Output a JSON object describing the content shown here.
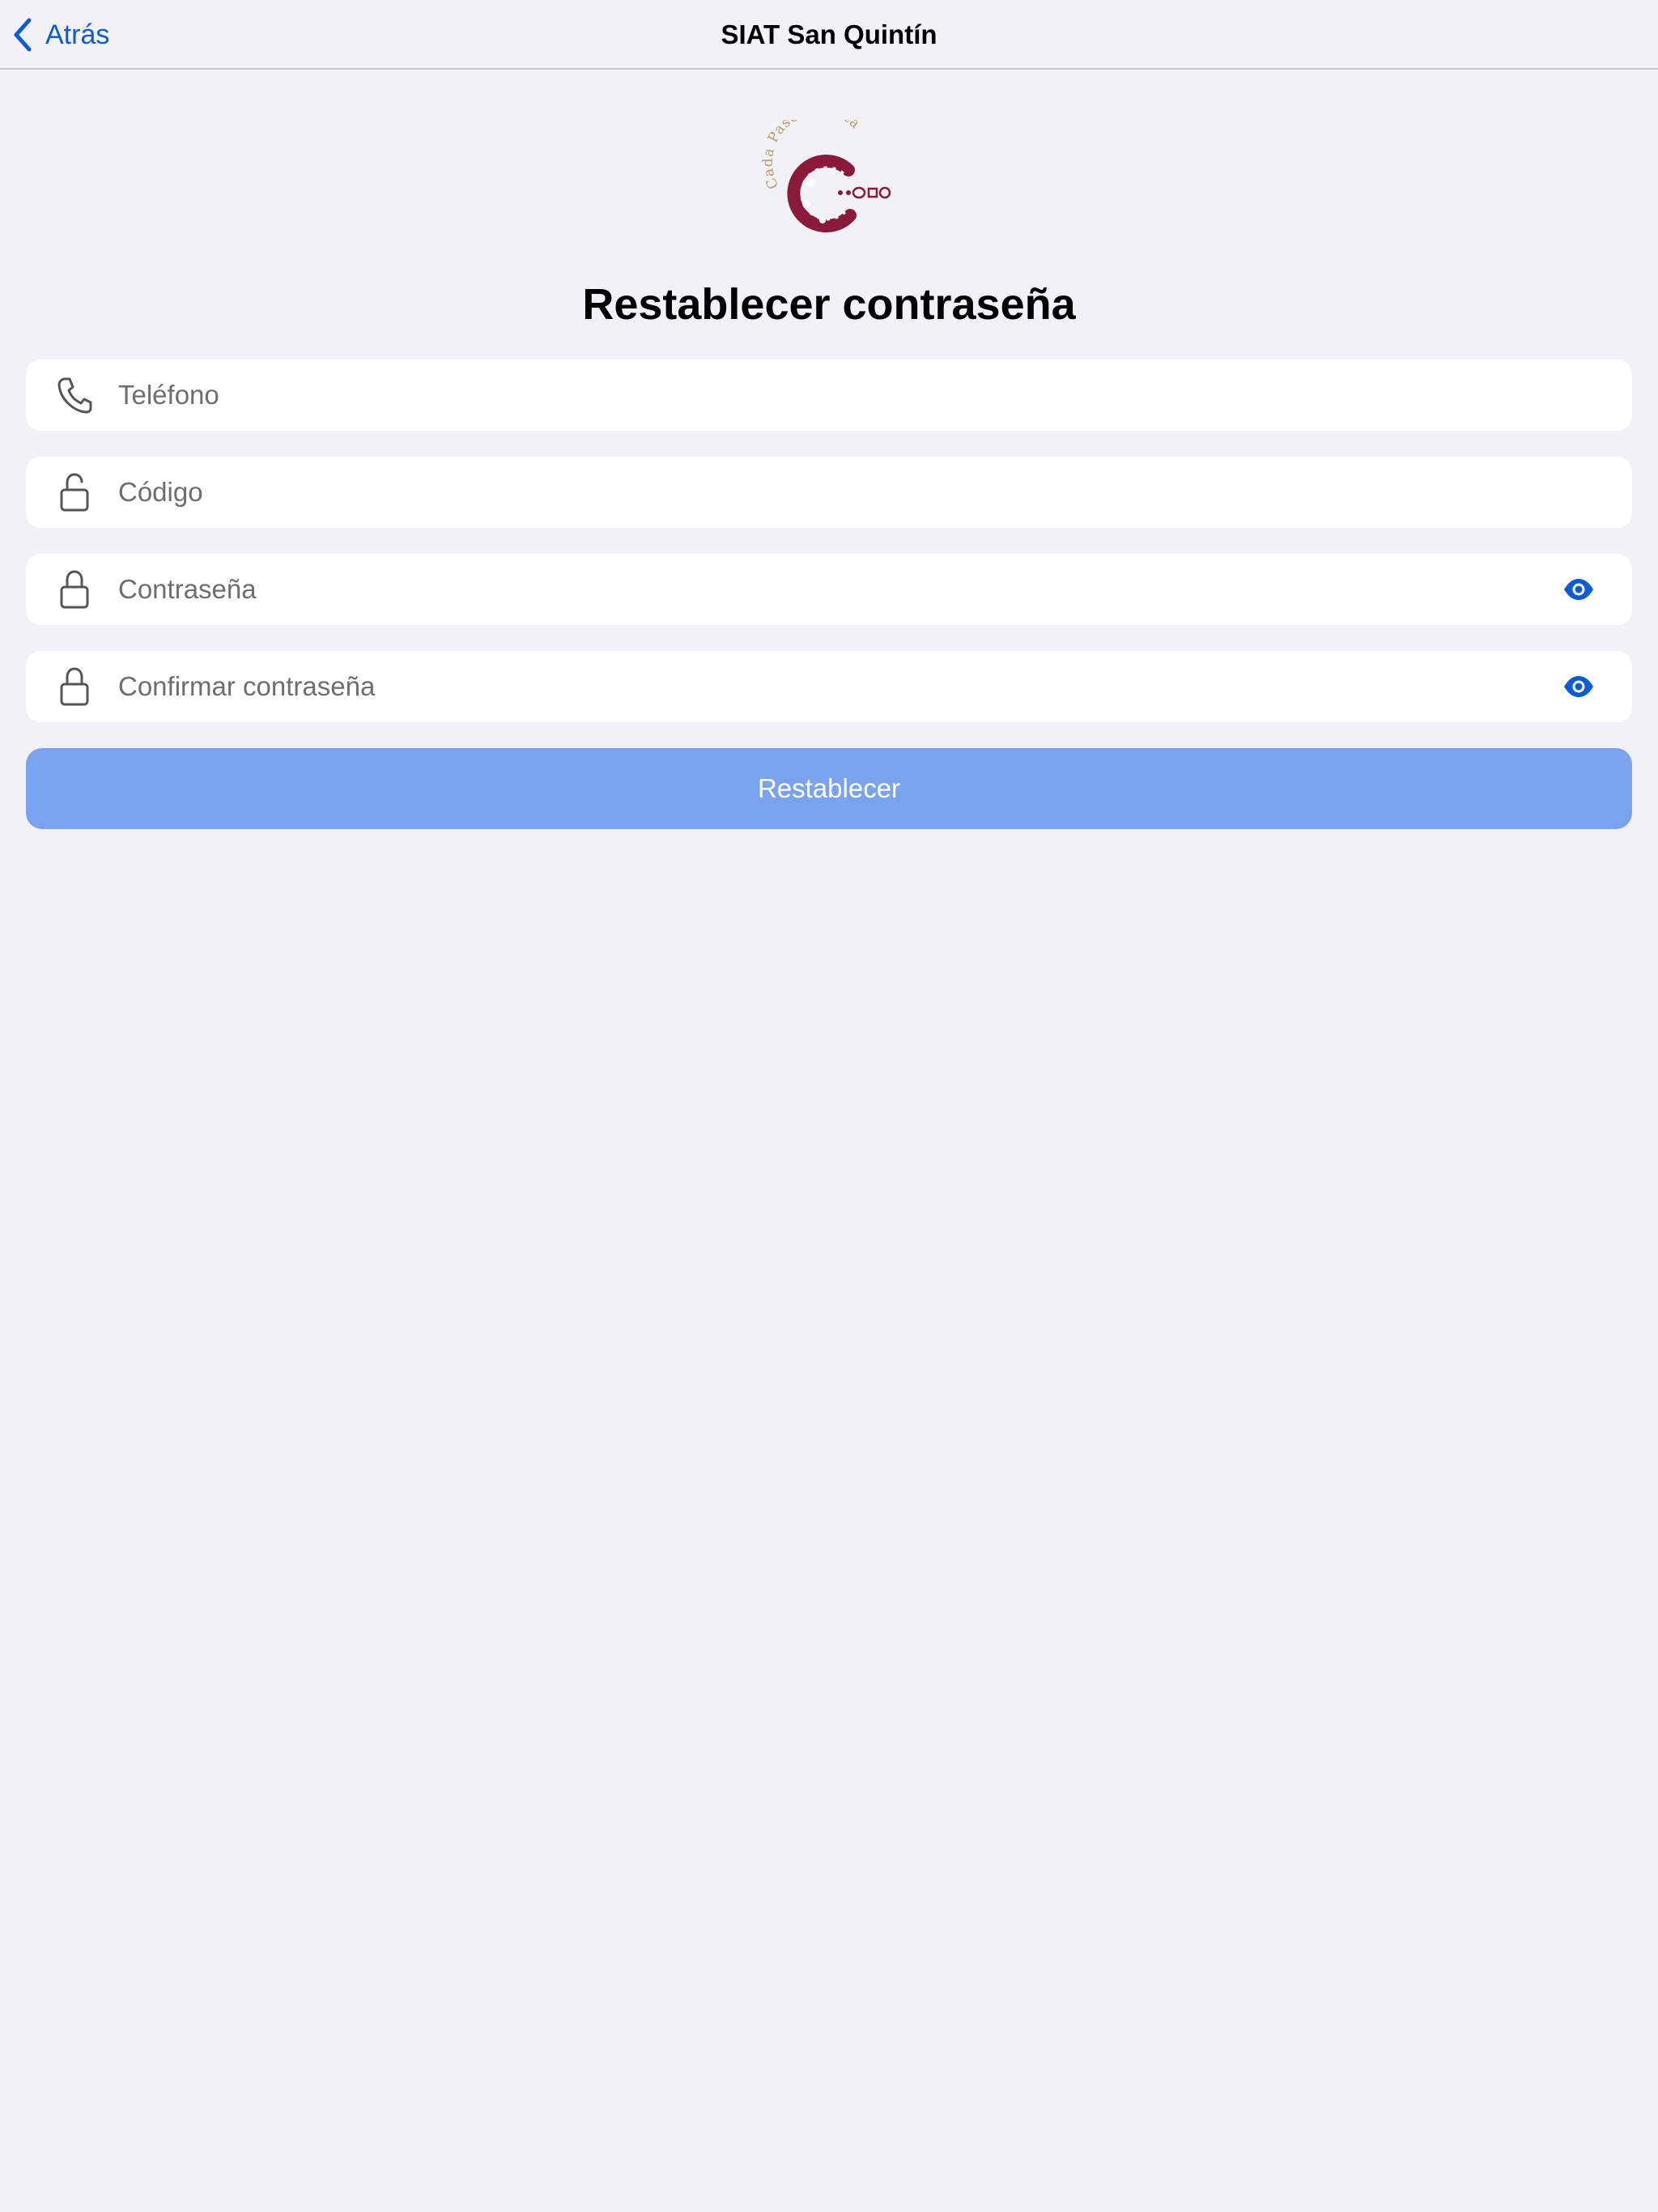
{
  "nav": {
    "back_label": "Atrás",
    "title": "SIAT San Quintín"
  },
  "logo": {
    "text": "Cada Paso Cuenta",
    "color_primary": "#8b1a3a",
    "color_text": "#b59a6a"
  },
  "page": {
    "title": "Restablecer contraseña"
  },
  "fields": {
    "phone": {
      "placeholder": "Teléfono",
      "value": "",
      "icon": "phone-icon"
    },
    "code": {
      "placeholder": "Código",
      "value": "",
      "icon": "lock-open-icon"
    },
    "password": {
      "placeholder": "Contraseña",
      "value": "",
      "icon": "lock-icon",
      "toggle_icon": "eye-icon"
    },
    "confirm_password": {
      "placeholder": "Confirmar contraseña",
      "value": "",
      "icon": "lock-icon",
      "toggle_icon": "eye-icon"
    }
  },
  "submit": {
    "label": "Restablecer"
  },
  "colors": {
    "accent": "#0a5bd8",
    "button_disabled": "#7aa3ef",
    "background": "#f1f1f6"
  }
}
